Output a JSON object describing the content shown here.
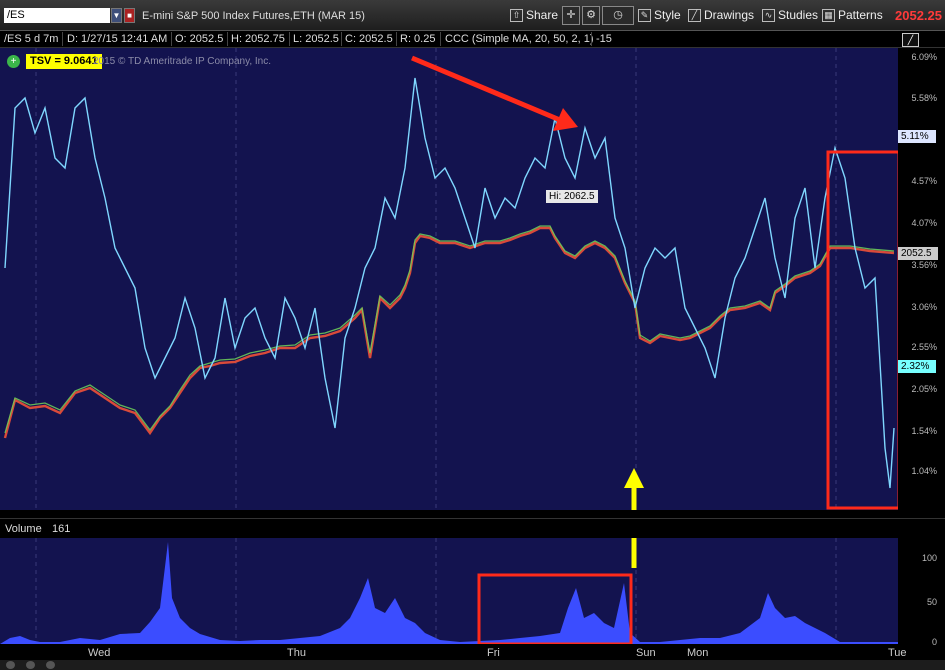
{
  "toolbar": {
    "symbol": "/ES",
    "instrument": "E-mini S&P 500 Index Futures,ETH (MAR 15)",
    "share_label": "Share",
    "style_label": "Style",
    "drawings_label": "Drawings",
    "studies_label": "Studies",
    "patterns_label": "Patterns",
    "last_price": "2052.25"
  },
  "infobar": {
    "chart_id": "/ES 5 d 7m",
    "date": "D: 1/27/15 12:41 AM",
    "open": "O: 2052.5",
    "high": "H: 2052.75",
    "low": "L: 2052.5",
    "close": "C: 2052.5",
    "range": "R: 0.25",
    "study": "CCC (Simple MA, 20, 50, 2, 1)",
    "study_value": "-15"
  },
  "price_pane": {
    "tsv_label": "TSV = 9.0641",
    "copyright": "2015 © TD Ameritrade IP Company, Inc.",
    "hi_label": "Hi: 2062.5",
    "ccc_tag": "5.11%",
    "price_tag": "2052.5",
    "ccc_tag2": "2.32%",
    "axis_ticks": [
      "6.09%",
      "5.58%",
      "4.57%",
      "4.07%",
      "3.56%",
      "3.06%",
      "2.55%",
      "2.05%",
      "1.54%",
      "1.04%"
    ]
  },
  "volume_pane": {
    "label": "Volume",
    "value": "161",
    "axis_ticks": [
      "100",
      "50",
      "0"
    ]
  },
  "dates": [
    "Wed",
    "Thu",
    "Fri",
    "Sun",
    "Mon",
    "Tue"
  ],
  "colors": {
    "pane_bg": "#13134f",
    "ccc_line": "#7fd7ff",
    "volume": "#3b4dff",
    "annotation_red": "#ff2a1a",
    "annotation_yellow": "#ffff00"
  }
}
